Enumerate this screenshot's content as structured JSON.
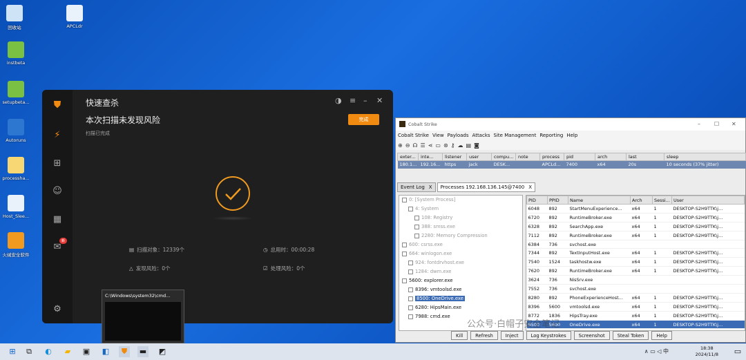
{
  "desktop": {
    "icons": [
      {
        "label": "回收站",
        "color": "#cfe3f7"
      },
      {
        "label": "APCLdr",
        "color": "#e9f1fb"
      },
      {
        "label": "instbeta",
        "color": "#7ac143"
      },
      {
        "label": "setupbeta...",
        "color": "#7ac143"
      },
      {
        "label": "Autoruns",
        "color": "#2e77d0"
      },
      {
        "label": "processha...",
        "color": "#f7d774"
      },
      {
        "label": "Host_Slee...",
        "color": "#e9f1fb"
      },
      {
        "label": "火绒安全软件",
        "color": "#f29a1f"
      }
    ]
  },
  "av_window": {
    "title": "快速查杀",
    "headline": "本次扫描未发现风险",
    "sub": "扫描已完成",
    "done_label": "完成",
    "stats": {
      "scanned": "扫描对象：12339个",
      "time": "总用时：00:00:28",
      "risks": "发现风险：0个",
      "handled": "处理风险：0个"
    },
    "badge": "新",
    "accent": "#f08a10"
  },
  "cmd_thumb": {
    "title": "C:\\Windows\\system32\\cmd..."
  },
  "cobalt": {
    "title": "Cobalt Strike",
    "menu": [
      "Cobalt Strike",
      "View",
      "Payloads",
      "Attacks",
      "Site Management",
      "Reporting",
      "Help"
    ],
    "beacon_headers": [
      "exter...",
      "inte...",
      "listener",
      "user",
      "compu...",
      "note",
      "process",
      "pid",
      "arch",
      "last",
      "sleep"
    ],
    "beacon_row": [
      "180.1...",
      "192.16...",
      "https",
      "jack",
      "DESK...",
      "",
      "APCLd...",
      "7400",
      "x64",
      "20s",
      "10 seconds (37% jitter)"
    ],
    "tabs": [
      "Event Log",
      "Processes 192.168.136.145@7400"
    ],
    "tab_close": "X",
    "tree": [
      {
        "text": "0: [System Process]",
        "indent": 0,
        "grey": true
      },
      {
        "text": "4: System",
        "indent": 1,
        "grey": true
      },
      {
        "text": "108: Registry",
        "indent": 2,
        "grey": true
      },
      {
        "text": "388: smss.exe",
        "indent": 2,
        "grey": true
      },
      {
        "text": "2280: Memory Compression",
        "indent": 2,
        "grey": true
      },
      {
        "text": "600: csrss.exe",
        "indent": 0,
        "grey": true
      },
      {
        "text": "664: winlogon.exe",
        "indent": 0,
        "grey": true
      },
      {
        "text": "924: fontdrvhost.exe",
        "indent": 1,
        "grey": true
      },
      {
        "text": "1284: dwm.exe",
        "indent": 1,
        "grey": true
      },
      {
        "text": "5600: explorer.exe",
        "indent": 0,
        "grey": false
      },
      {
        "text": "8396: vmtoolsd.exe",
        "indent": 1,
        "grey": false
      },
      {
        "text": "8500: OneDrive.exe",
        "indent": 1,
        "grey": false,
        "sel": true
      },
      {
        "text": "6280: HipsMain.exe",
        "indent": 1,
        "grey": false
      },
      {
        "text": "7988: cmd.exe",
        "indent": 1,
        "grey": false
      }
    ],
    "proc_headers": [
      "PID",
      "PPID",
      "Name",
      "Arch",
      "Sessi...",
      "User"
    ],
    "proc_rows": [
      [
        "6048",
        "892",
        "StartMenuExperience...",
        "x64",
        "1",
        "DESKTOP-S2H9TTK\\j..."
      ],
      [
        "6720",
        "892",
        "RuntimeBroker.exe",
        "x64",
        "1",
        "DESKTOP-S2H9TTK\\j..."
      ],
      [
        "6328",
        "892",
        "SearchApp.exe",
        "x64",
        "1",
        "DESKTOP-S2H9TTK\\j..."
      ],
      [
        "7112",
        "892",
        "RuntimeBroker.exe",
        "x64",
        "1",
        "DESKTOP-S2H9TTK\\j..."
      ],
      [
        "6384",
        "736",
        "svchost.exe",
        "",
        "",
        ""
      ],
      [
        "7344",
        "892",
        "TextInputHost.exe",
        "x64",
        "1",
        "DESKTOP-S2H9TTK\\j..."
      ],
      [
        "7540",
        "1524",
        "taskhostw.exe",
        "x64",
        "1",
        "DESKTOP-S2H9TTK\\j..."
      ],
      [
        "7620",
        "892",
        "RuntimeBroker.exe",
        "x64",
        "1",
        "DESKTOP-S2H9TTK\\j..."
      ],
      [
        "3624",
        "736",
        "NisSrv.exe",
        "",
        "",
        ""
      ],
      [
        "7552",
        "736",
        "svchost.exe",
        "",
        "",
        ""
      ],
      [
        "8280",
        "892",
        "PhoneExperienceHost...",
        "x64",
        "1",
        "DESKTOP-S2H9TTK\\j..."
      ],
      [
        "8396",
        "5600",
        "vmtoolsd.exe",
        "x64",
        "1",
        "DESKTOP-S2H9TTK\\j..."
      ],
      [
        "8772",
        "1836",
        "HipsTray.exe",
        "x64",
        "1",
        "DESKTOP-S2H9TTK\\j..."
      ],
      [
        "8500",
        "5600",
        "OneDrive.exe",
        "x64",
        "1",
        "DESKTOP-S2H9TTK\\j..."
      ]
    ],
    "selected_row": 13,
    "buttons": [
      "Kill",
      "Refresh",
      "Inject",
      "Log Keystrokes",
      "Screenshot",
      "Steal Token",
      "Help"
    ]
  },
  "taskbar": {
    "time": "18:38",
    "date": "2024/11/8",
    "ime": "中",
    "watermark": "公众号·白帽子安全笔记"
  }
}
